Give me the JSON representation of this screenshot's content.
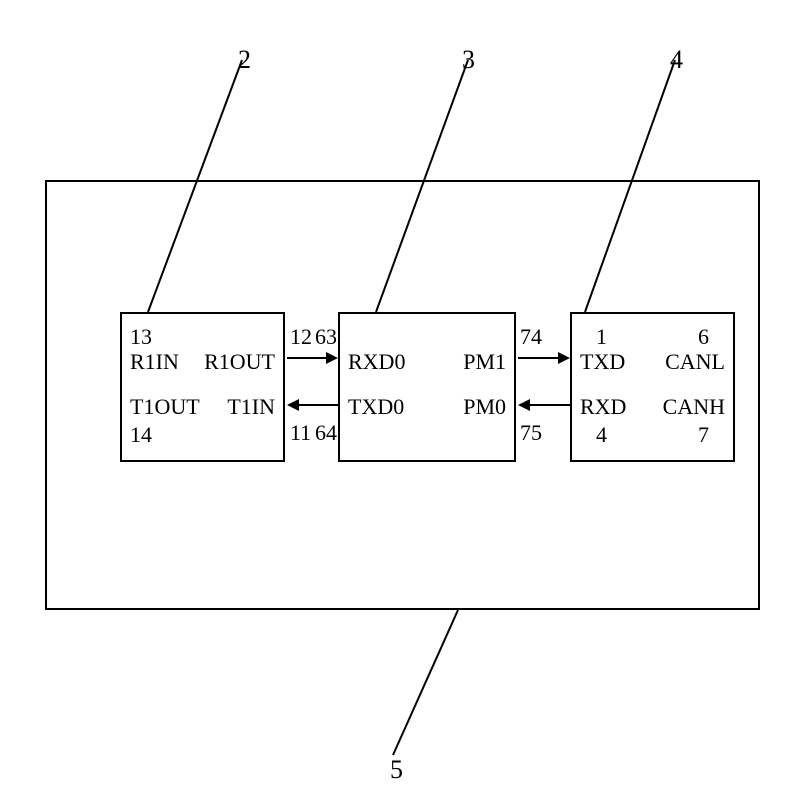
{
  "labels": {
    "ref2": "2",
    "ref3": "3",
    "ref4": "4",
    "ref5": "5"
  },
  "block2": {
    "r1in_num": "13",
    "r1in": "R1IN",
    "r1out": "R1OUT",
    "r1out_num": "12",
    "t1out_num": "14",
    "t1out": "T1OUT",
    "t1in": "T1IN",
    "t1in_num": "11"
  },
  "block3": {
    "rxd0_num": "63",
    "rxd0": "RXD0",
    "pm1": "PM1",
    "pm1_num": "74",
    "txd0_num": "64",
    "txd0": "TXD0",
    "pm0": "PM0",
    "pm0_num": "75"
  },
  "block4": {
    "txd_num": "1",
    "txd": "TXD",
    "canl": "CANL",
    "canl_num": "6",
    "rxd_num": "4",
    "rxd": "RXD",
    "canh": "CANH",
    "canh_num": "7"
  }
}
